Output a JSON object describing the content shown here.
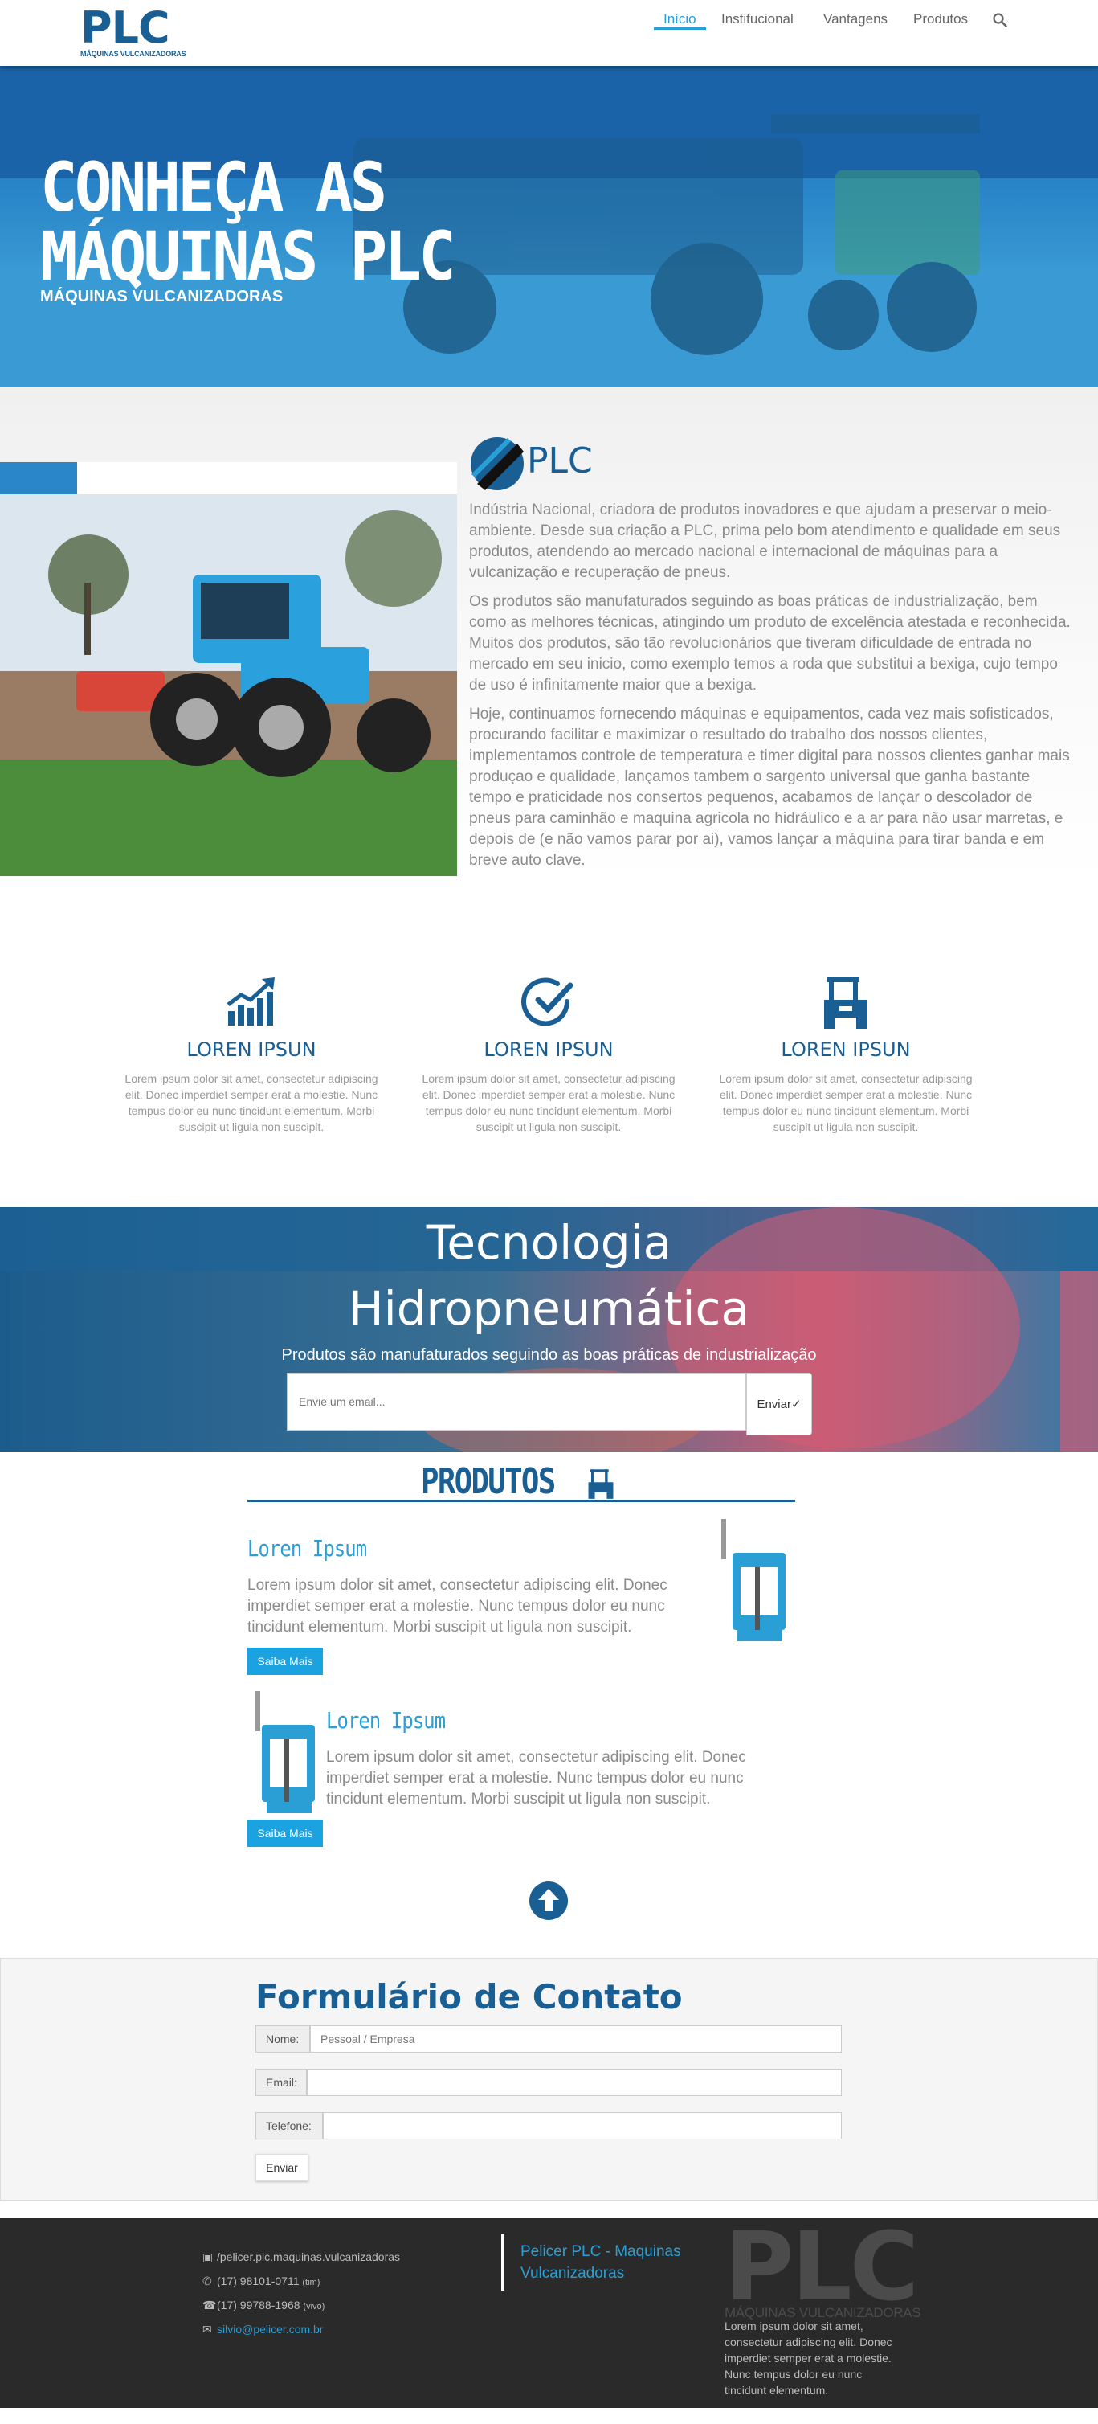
{
  "nav": {
    "logo_big": "PLC",
    "logo_small": "MÁQUINAS VULCANIZADORAS",
    "items": [
      "Início",
      "Institucional",
      "Vantagens",
      "Produtos"
    ],
    "search_icon": "search-icon"
  },
  "hero": {
    "title_line1": "CONHEÇA AS",
    "title_line2": "MÁQUINAS PLC",
    "subtitle": "MÁQUINAS VULCANIZADORAS"
  },
  "about": {
    "brand": "PLC",
    "p1": "Indústria Nacional, criadora de produtos inovadores e que ajudam a preservar o meio-ambiente. Desde sua criação a PLC, prima pelo bom atendimento e qualidade em seus produtos, atendendo ao mercado nacional e internacional de máquinas para a vulcanização e recuperação de pneus.",
    "p2": "Os produtos são manufaturados seguindo as boas práticas de industrialização, bem como as melhores técnicas, atingindo um produto de excelência atestada e reconhecida. Muitos dos produtos, são tão revolucionários que tiveram dificuldade de entrada no mercado em seu inicio, como exemplo temos a roda que substitui a bexiga, cujo tempo de uso é infinitamente maior que a bexiga.",
    "p3": "Hoje, continuamos fornecendo máquinas e equipamentos, cada vez mais sofisticados, procurando facilitar e maximizar o resultado do trabalho dos nossos clientes, implementamos controle de temperatura e timer digital para nossos clientes ganhar mais produçao e qualidade, lançamos tambem o sargento universal que ganha bastante tempo e praticidade nos consertos pequenos, acabamos de lançar o descolador de pneus para caminhão e maquina agricola no hidráulico e a ar para não usar marretas, e depois de (e não vamos parar por ai), vamos lançar a máquina para tirar banda e em breve auto clave."
  },
  "features": [
    {
      "icon": "growth-chart-icon",
      "title": "LOREN IPSUN",
      "text": "Lorem ipsum dolor sit amet, consectetur adipiscing elit. Donec imperdiet semper erat a molestie. Nunc tempus dolor eu nunc tincidunt elementum. Morbi suscipit ut ligula non suscipit."
    },
    {
      "icon": "check-circle-icon",
      "title": "LOREN IPSUN",
      "text": "Lorem ipsum dolor sit amet, consectetur adipiscing elit. Donec imperdiet semper erat a molestie. Nunc tempus dolor eu nunc tincidunt elementum. Morbi suscipit ut ligula non suscipit."
    },
    {
      "icon": "tractor-icon",
      "title": "LOREN IPSUN",
      "text": "Lorem ipsum dolor sit amet, consectetur adipiscing elit. Donec imperdiet semper erat a molestie. Nunc tempus dolor eu nunc tincidunt elementum. Morbi suscipit ut ligula non suscipit."
    }
  ],
  "tech": {
    "line1": "Tecnologia",
    "line2": "Hidropneumática",
    "subtitle": "Produtos são manufaturados seguindo as boas práticas de industrialização",
    "email_placeholder": "Envie um email...",
    "send_label": "Enviar"
  },
  "products": {
    "title": "PRODUTOS",
    "items": [
      {
        "name": "Loren Ipsum",
        "desc": "Lorem ipsum dolor sit amet, consectetur adipiscing elit. Donec imperdiet semper erat a molestie. Nunc tempus dolor eu nunc tincidunt elementum. Morbi suscipit ut ligula non suscipit.",
        "button": "Saiba Mais"
      },
      {
        "name": "Loren Ipsum",
        "desc": "Lorem ipsum dolor sit amet, consectetur adipiscing elit. Donec imperdiet semper erat a molestie. Nunc tempus dolor eu nunc tincidunt elementum. Morbi suscipit ut ligula non suscipit.",
        "button": "Saiba Mais"
      }
    ]
  },
  "contact": {
    "title": "Formulário de Contato",
    "name_label": "Nome:",
    "name_placeholder": "Pessoal / Empresa",
    "email_label": "Email:",
    "phone_label": "Telefone:",
    "send_label": "Enviar"
  },
  "footer": {
    "facebook": "/pelicer.plc.maquinas.vulcanizadoras",
    "phone1": "(17) 98101-0711",
    "phone1_carrier": "(tim)",
    "phone2": "(17) 99788-1968",
    "phone2_carrier": "(vivo)",
    "email": "silvio@pelicer.com.br",
    "brand": "Pelicer PLC - Maquinas Vulcanizadoras",
    "logo_big": "PLC",
    "logo_small": "MÁQUINAS VULCANIZADORAS",
    "lorem": "Lorem ipsum dolor sit amet, consectetur adipiscing elit. Donec imperdiet semper erat a molestie. Nunc tempus dolor eu nunc tincidunt elementum."
  },
  "colors": {
    "brand": "#1a5f94",
    "accent": "#2a9fd6",
    "button": "#1aa3e0",
    "footer": "#2a2a2a"
  }
}
